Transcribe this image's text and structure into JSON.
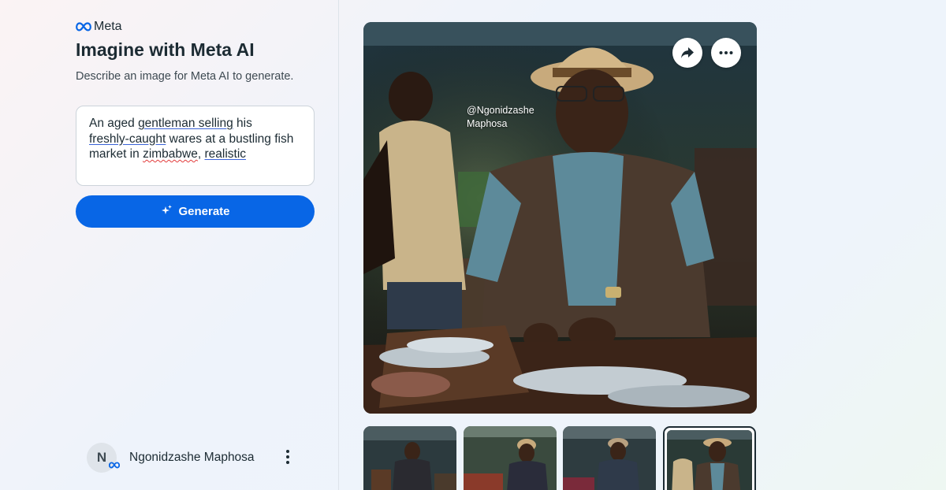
{
  "brand": {
    "name": "Meta",
    "logo_icon": "meta-infinity-icon"
  },
  "header": {
    "title": "Imagine with Meta AI",
    "subtitle": "Describe an image for Meta AI to generate."
  },
  "prompt": {
    "value": "An aged gentleman  selling his freshly-caught wares at a bustling fish market in zimbabwe, realistic",
    "parts": [
      "An aged ",
      "gentleman  selling",
      " his ",
      "freshly-caught",
      " wares at a bustling fish market in ",
      "zimbabwe",
      ", ",
      "realistic"
    ]
  },
  "generate_button": {
    "label": "Generate",
    "icon": "sparkle-icon"
  },
  "user": {
    "initial": "N",
    "name": "Ngonidzashe Maphosa",
    "menu_icon": "kebab-icon"
  },
  "image": {
    "watermark_line1": "@Ngonidzashe",
    "watermark_line2": "Maphosa",
    "share_icon": "share-arrow-icon",
    "more_icon": "ellipsis-icon"
  },
  "thumbnails": [
    {
      "name": "variation-1"
    },
    {
      "name": "variation-2"
    },
    {
      "name": "variation-3"
    },
    {
      "name": "variation-4",
      "selected": true
    }
  ],
  "colors": {
    "accent": "#0866e6",
    "text": "#1c2b33"
  }
}
